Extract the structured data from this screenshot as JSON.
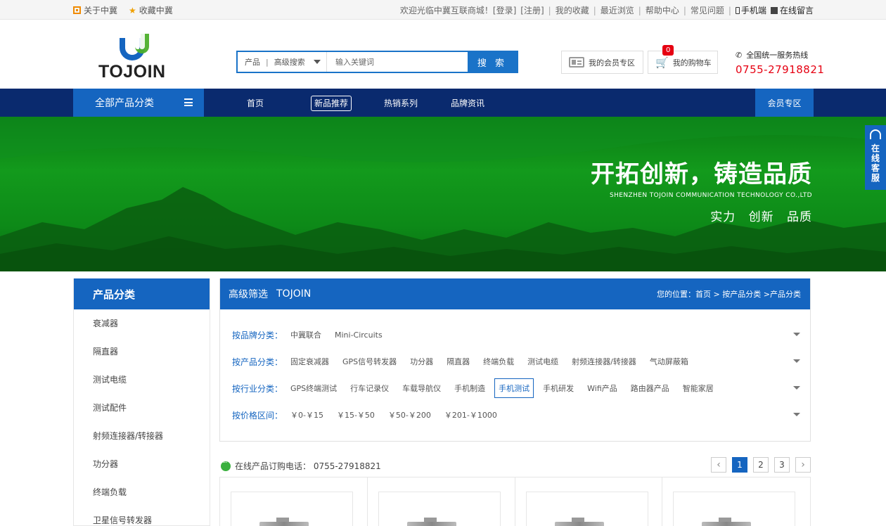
{
  "topbar": {
    "about": "关于中冀",
    "favorite": "收藏中冀",
    "welcome": "欢迎光临中冀互联商城！",
    "login": "[登录]",
    "register": "[注册]",
    "my_favorites": "我的收藏",
    "recent": "最近浏览",
    "help": "帮助中心",
    "faq": "常见问题",
    "mobile": "手机端",
    "message": "在线留言"
  },
  "header": {
    "logo_text": "TOJOIN",
    "search": {
      "category": "产品",
      "advanced": "高级搜索",
      "placeholder": "输入关键词",
      "button": "搜 索"
    },
    "member_zone": "我的会员专区",
    "cart": "我的购物车",
    "cart_count": "0",
    "hotline_label": "全国统一服务热线",
    "hotline_number": "0755-27918821"
  },
  "nav": {
    "all_categories": "全部产品分类",
    "links": [
      "首页",
      "新品推荐",
      "热销系列",
      "品牌资讯"
    ],
    "active_index": 1,
    "member_zone": "会员专区"
  },
  "banner": {
    "title": "开拓创新，铸造品质",
    "subtitle": "SHENZHEN TOJOIN COMMUNICATION TECHNOLOGY CO.,LTD",
    "slogan": "实力 创新 品质"
  },
  "float_service": "在线客服",
  "sidebar": {
    "title": "产品分类",
    "items": [
      "衰减器",
      "隔直器",
      "测试电缆",
      "测试配件",
      "射频连接器/转接器",
      "功分器",
      "终端负载",
      "卫星信号转发器"
    ]
  },
  "filter": {
    "title": "高级筛选",
    "brand": "TOJOIN",
    "breadcrumb": "您的位置：首页 > 按产品分类 >产品分类",
    "rows": [
      {
        "label": "按品牌分类：",
        "options": [
          "中冀联合",
          "Mini-Circuits"
        ]
      },
      {
        "label": "按产品分类：",
        "options": [
          "固定衰减器",
          "GPS信号转发器",
          "功分器",
          "隔直器",
          "终端负载",
          "测试电缆",
          "射频连接器/转接器",
          "气动屏蔽箱"
        ]
      },
      {
        "label": "按行业分类：",
        "options": [
          "GPS终端测试",
          "行车记录仪",
          "车载导航仪",
          "手机制造",
          "手机测试",
          "手机研发",
          "Wifi产品",
          "路由器产品",
          "智能家居"
        ],
        "selected": 4
      },
      {
        "label": "按价格区间：",
        "options": [
          "￥0-￥15",
          "￥15-￥50",
          "￥50-￥200",
          "￥201-￥1000"
        ]
      }
    ]
  },
  "products_bar": {
    "phone": "在线产品订购电话： 0755-27918821",
    "pages": [
      "1",
      "2",
      "3"
    ],
    "current_page": "1"
  },
  "colors": {
    "primary": "#1565c0",
    "nav_bg": "#0a2a6e",
    "hotline": "#e60012",
    "banner": "#0d8a18"
  }
}
